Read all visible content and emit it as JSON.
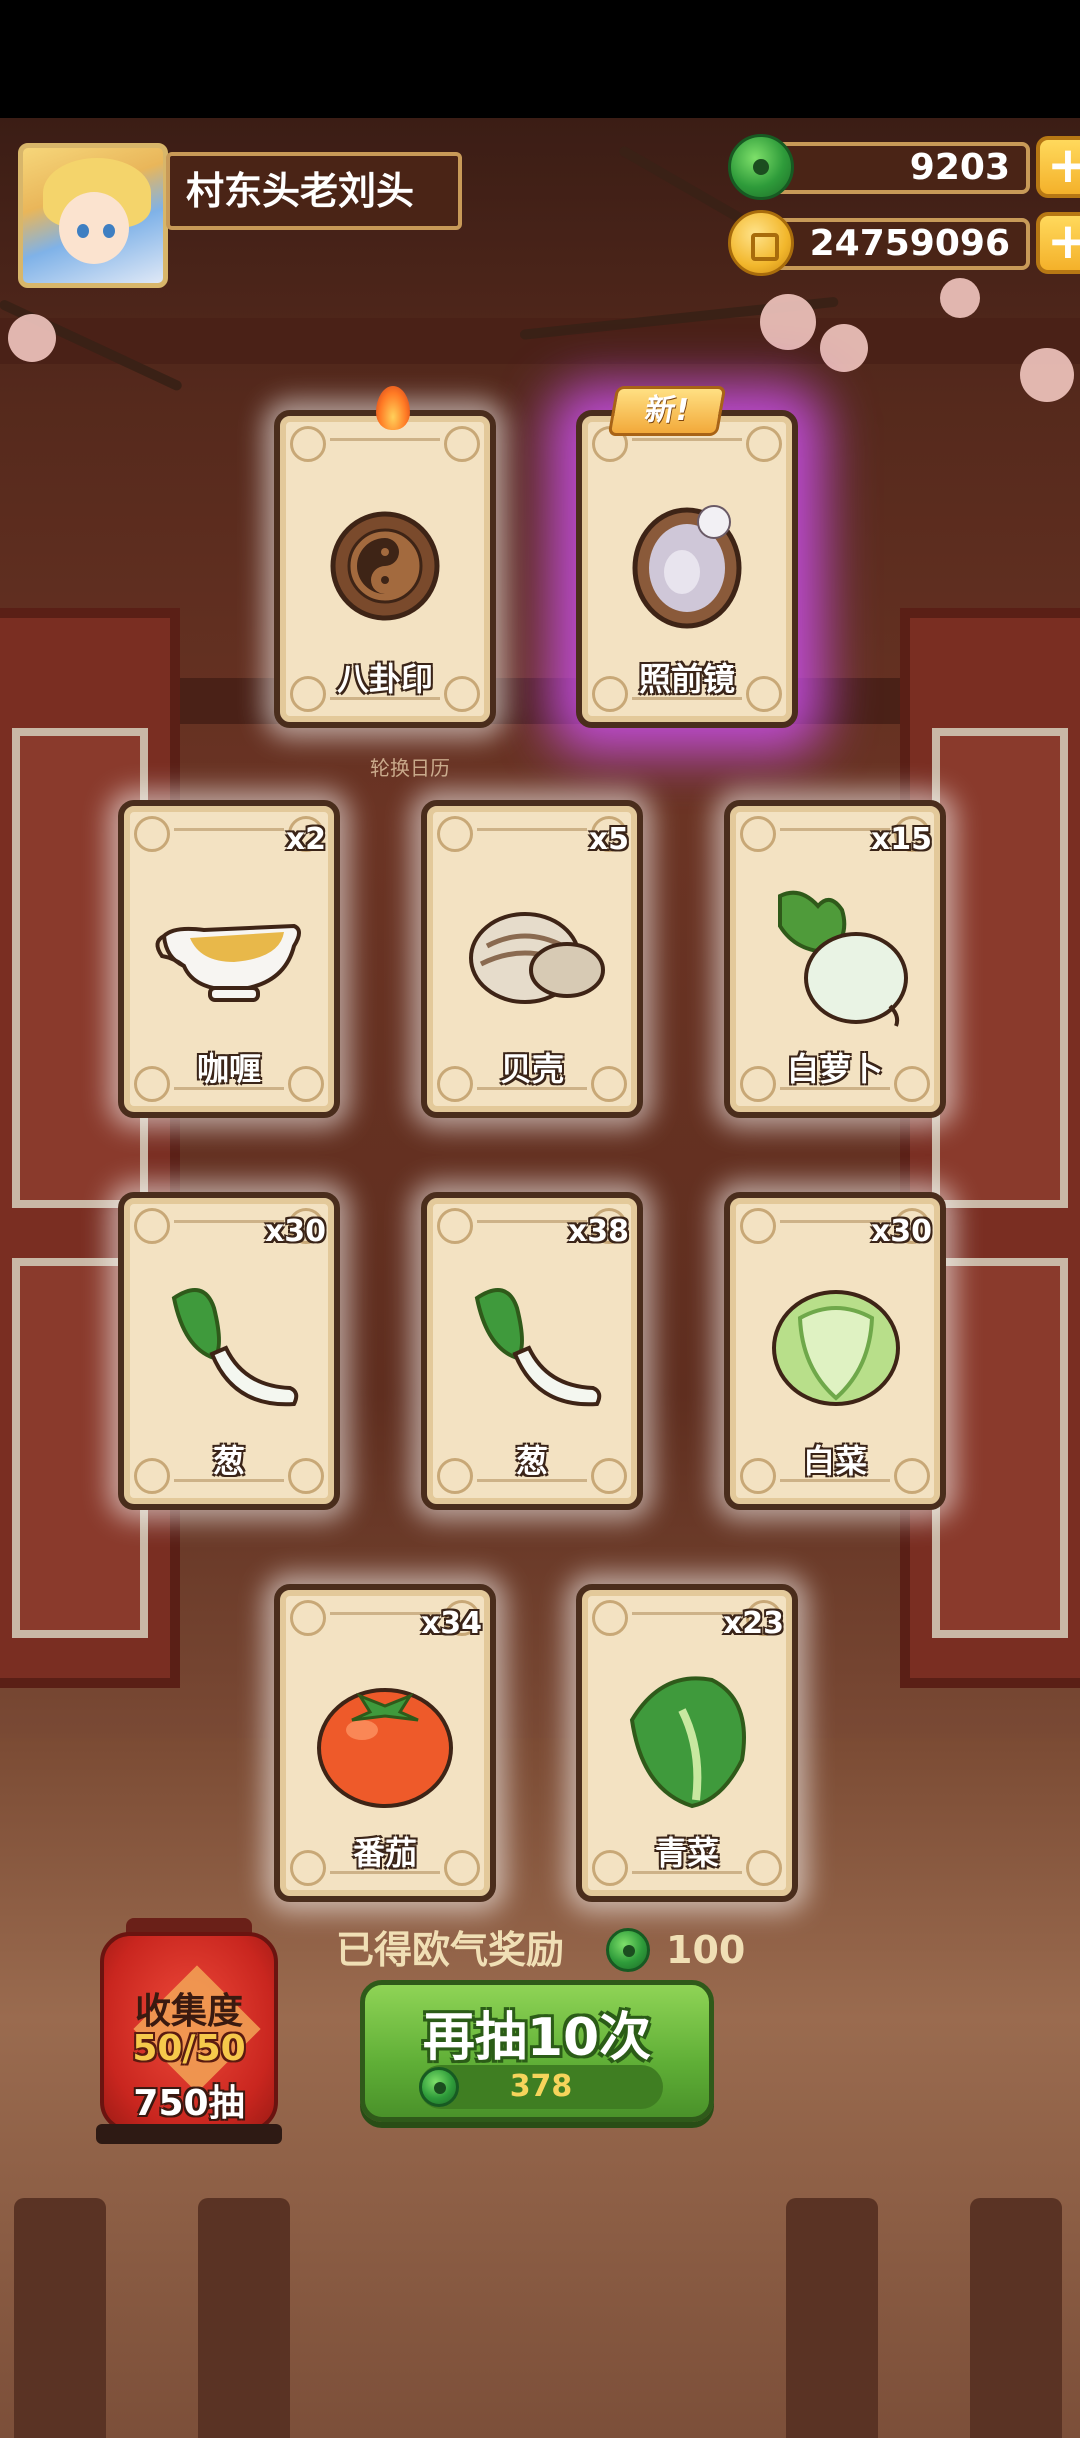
{
  "player": {
    "name": "村东头老刘头"
  },
  "currencies": {
    "jade": {
      "value": "9203",
      "icon": "jade-icon"
    },
    "coins": {
      "value": "24759096",
      "icon": "coin-icon"
    },
    "add_label": "+"
  },
  "special_cards": [
    {
      "label": "八卦印",
      "icon": "bagua-seal-icon",
      "badge": "",
      "marker": "flame-icon"
    },
    {
      "label": "照前镜",
      "icon": "mirror-icon",
      "badge": "新!",
      "marker": ""
    }
  ],
  "banner_caption": "轮换日历",
  "cards": [
    {
      "label": "咖喱",
      "count": "x2",
      "icon": "curry-gravy-boat-icon"
    },
    {
      "label": "贝壳",
      "count": "x5",
      "icon": "clam-shell-icon"
    },
    {
      "label": "白萝卜",
      "count": "x15",
      "icon": "white-radish-icon"
    },
    {
      "label": "葱",
      "count": "x30",
      "icon": "green-onion-icon"
    },
    {
      "label": "葱",
      "count": "x38",
      "icon": "green-onion-icon"
    },
    {
      "label": "白菜",
      "count": "x30",
      "icon": "napa-cabbage-icon"
    },
    {
      "label": "番茄",
      "count": "x34",
      "icon": "tomato-icon"
    },
    {
      "label": "青菜",
      "count": "x23",
      "icon": "bok-choy-icon"
    }
  ],
  "reward": {
    "label": "已得欧气奖励",
    "value": "100"
  },
  "redraw": {
    "label": "再抽10次",
    "cost": "378"
  },
  "collection": {
    "title": "收集度",
    "progress": "50/50",
    "draws": "750抽"
  },
  "colors": {
    "accent_green": "#5fae36",
    "jade": "#2e9b3a",
    "gold": "#f4b12a",
    "card_bg": "#f3e2c2",
    "new_glow": "#cd50f0"
  }
}
